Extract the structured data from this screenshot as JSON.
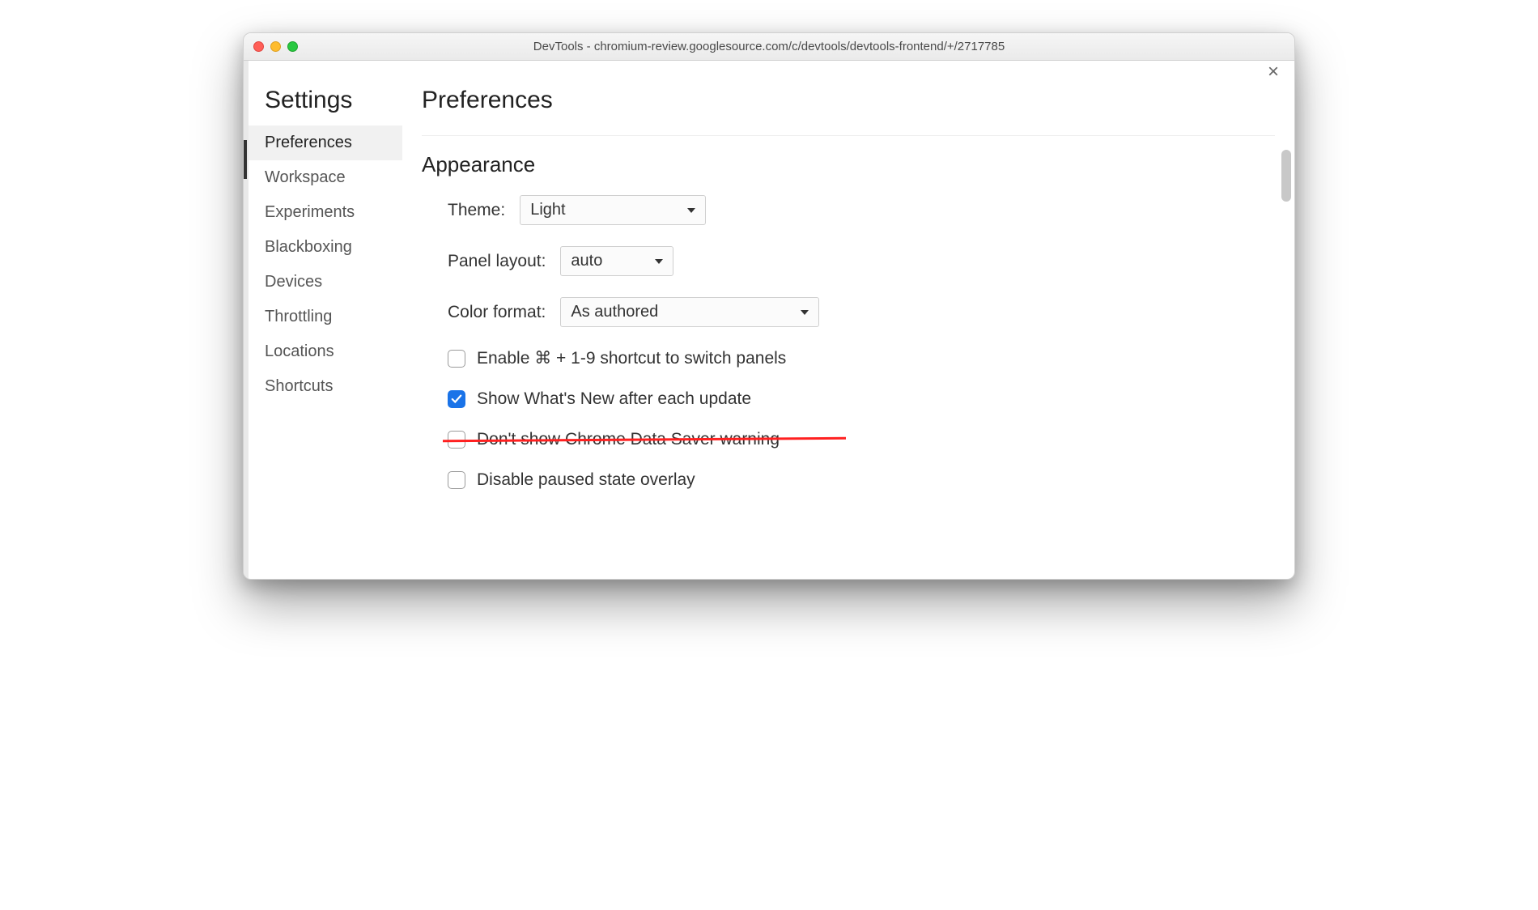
{
  "titlebar": {
    "title": "DevTools - chromium-review.googlesource.com/c/devtools/devtools-frontend/+/2717785"
  },
  "sidebar": {
    "heading": "Settings",
    "items": [
      {
        "label": "Preferences",
        "active": true
      },
      {
        "label": "Workspace",
        "active": false
      },
      {
        "label": "Experiments",
        "active": false
      },
      {
        "label": "Blackboxing",
        "active": false
      },
      {
        "label": "Devices",
        "active": false
      },
      {
        "label": "Throttling",
        "active": false
      },
      {
        "label": "Locations",
        "active": false
      },
      {
        "label": "Shortcuts",
        "active": false
      }
    ]
  },
  "main": {
    "title": "Preferences",
    "close_label": "×",
    "section_title": "Appearance",
    "theme_label": "Theme:",
    "theme_value": "Light",
    "panel_label": "Panel layout:",
    "panel_value": "auto",
    "color_label": "Color format:",
    "color_value": "As authored",
    "checks": [
      {
        "label": "Enable ⌘ + 1-9 shortcut to switch panels",
        "checked": false,
        "struck": false
      },
      {
        "label": "Show What's New after each update",
        "checked": true,
        "struck": false
      },
      {
        "label": "Don't show Chrome Data Saver warning",
        "checked": false,
        "struck": true
      },
      {
        "label": "Disable paused state overlay",
        "checked": false,
        "struck": false
      }
    ]
  }
}
